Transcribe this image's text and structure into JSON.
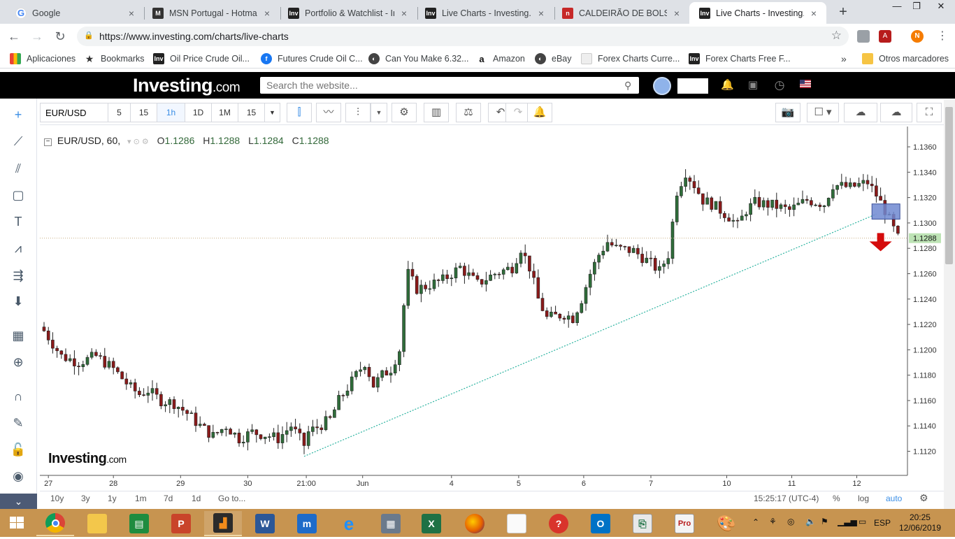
{
  "browser": {
    "tabs": [
      {
        "title": "Google",
        "favicon": "google-icon",
        "color": "#4285f4"
      },
      {
        "title": "MSN Portugal - Hotmail,",
        "favicon": "msn-icon",
        "color": "#333333"
      },
      {
        "title": "Portfolio & Watchlist - In",
        "favicon": "investing-icon",
        "color": "#222222"
      },
      {
        "title": "Live Charts - Investing.co",
        "favicon": "investing-icon",
        "color": "#222222"
      },
      {
        "title": "CALDEIRÃO DE BOLSA -",
        "favicon": "caldeirao-icon",
        "color": "#c62828"
      },
      {
        "title": "Live Charts - Investing.co",
        "favicon": "investing-icon",
        "color": "#222222",
        "active": true
      }
    ],
    "url": "https://www.investing.com/charts/live-charts",
    "profile_initial": "N",
    "bookmarks": [
      {
        "label": "Aplicaciones",
        "icon": "apps-grid-icon"
      },
      {
        "label": "Bookmarks",
        "icon": "star-icon"
      },
      {
        "label": "Oil Price  Crude Oil...",
        "icon": "investing-icon"
      },
      {
        "label": "Futures Crude Oil C...",
        "icon": "facebook-icon"
      },
      {
        "label": "Can You Make 6.32...",
        "icon": "globe-icon"
      },
      {
        "label": "Amazon",
        "icon": "amazon-icon"
      },
      {
        "label": "eBay",
        "icon": "globe-icon"
      },
      {
        "label": "Forex Charts  Curre...",
        "icon": "page-icon"
      },
      {
        "label": "Forex Charts  Free F...",
        "icon": "investing-icon"
      }
    ],
    "bookmarks_more": "»",
    "other_bookmarks": "Otros marcadores"
  },
  "investing": {
    "logo": "Investing",
    "logo_suffix": ".com",
    "search_placeholder": "Search the website..."
  },
  "chart_toolbar": {
    "symbol": "EUR/USD",
    "intervals": [
      "5",
      "15",
      "1h",
      "1D",
      "1M",
      "15"
    ],
    "selected_interval": "1h"
  },
  "legend": {
    "title": "EUR/USD, 60,",
    "o_label": "O",
    "o_value": "1.1286",
    "h_label": "H",
    "h_value": "1.1288",
    "l_label": "L",
    "l_value": "1.1284",
    "c_label": "C",
    "c_value": "1.1288"
  },
  "watermark": {
    "logo": "Investing",
    "suffix": ".com"
  },
  "range_bar": {
    "ranges": [
      "10y",
      "3y",
      "1y",
      "1m",
      "7d",
      "1d"
    ],
    "goto": "Go to...",
    "time": "15:25:17 (UTC-4)",
    "percent": "%",
    "log": "log",
    "auto": "auto"
  },
  "taskbar": {
    "language": "ESP",
    "time": "20:25",
    "date": "12/06/2019"
  },
  "colors": {
    "candle_up": "#2f6d3a",
    "candle_down": "#8b1a1a",
    "trendline": "#2bb3a0",
    "price_line": "#c9b084",
    "price_tag": "#bde3b5",
    "highlight_box": "#6f88d1",
    "arrow": "#d40c0c"
  },
  "chart_data": {
    "type": "candlestick",
    "symbol": "EUR/USD",
    "interval": "60",
    "y_ticks": [
      1.136,
      1.134,
      1.132,
      1.13,
      1.128,
      1.126,
      1.124,
      1.122,
      1.12,
      1.118,
      1.116,
      1.114,
      1.112
    ],
    "y_tick_labels": [
      "1.1360",
      "1.1340",
      "1.1320",
      "1.1300",
      "1.1280",
      "1.1260",
      "1.1240",
      "1.1220",
      "1.1200",
      "1.1180",
      "1.1160",
      "1.1140",
      "1.1120"
    ],
    "ylim": [
      1.1101,
      1.1376
    ],
    "x_ticks": [
      "27",
      "28",
      "29",
      "30",
      "21:00",
      "Jun",
      "4",
      "5",
      "6",
      "7",
      "10",
      "11",
      "12"
    ],
    "last_price": "1.1288",
    "last_price_value": 1.1288,
    "close_path": [
      [
        0,
        1.1215
      ],
      [
        4,
        1.1195
      ],
      [
        8,
        1.119
      ],
      [
        12,
        1.1195
      ],
      [
        16,
        1.1185
      ],
      [
        20,
        1.117
      ],
      [
        22,
        1.1165
      ],
      [
        24,
        1.1168
      ],
      [
        27,
        1.116
      ],
      [
        30,
        1.1158
      ],
      [
        33,
        1.115
      ],
      [
        36,
        1.114
      ],
      [
        39,
        1.1132
      ],
      [
        42,
        1.114
      ],
      [
        45,
        1.113
      ],
      [
        48,
        1.1135
      ],
      [
        51,
        1.1133
      ],
      [
        54,
        1.113
      ],
      [
        57,
        1.114
      ],
      [
        60,
        1.1125
      ],
      [
        61,
        1.1135
      ],
      [
        66,
        1.1145
      ],
      [
        68,
        1.116
      ],
      [
        70,
        1.117
      ],
      [
        72,
        1.118
      ],
      [
        74,
        1.119
      ],
      [
        76,
        1.1172
      ],
      [
        78,
        1.118
      ],
      [
        80,
        1.1185
      ],
      [
        82,
        1.12
      ],
      [
        83,
        1.1235
      ],
      [
        84,
        1.126
      ],
      [
        86,
        1.1248
      ],
      [
        88,
        1.125
      ],
      [
        92,
        1.1255
      ],
      [
        96,
        1.1265
      ],
      [
        100,
        1.1252
      ],
      [
        104,
        1.126
      ],
      [
        108,
        1.1265
      ],
      [
        110,
        1.128
      ],
      [
        112,
        1.1265
      ],
      [
        114,
        1.124
      ],
      [
        116,
        1.1225
      ],
      [
        120,
        1.1228
      ],
      [
        122,
        1.1225
      ],
      [
        124,
        1.124
      ],
      [
        126,
        1.126
      ],
      [
        128,
        1.1275
      ],
      [
        130,
        1.1285
      ],
      [
        132,
        1.128
      ],
      [
        136,
        1.1278
      ],
      [
        140,
        1.1268
      ],
      [
        142,
        1.1262
      ],
      [
        144,
        1.1275
      ],
      [
        146,
        1.1325
      ],
      [
        148,
        1.134
      ],
      [
        150,
        1.133
      ],
      [
        152,
        1.1318
      ],
      [
        154,
        1.1315
      ],
      [
        156,
        1.131
      ],
      [
        158,
        1.1305
      ],
      [
        160,
        1.1298
      ],
      [
        162,
        1.131
      ],
      [
        164,
        1.1316
      ],
      [
        168,
        1.1314
      ],
      [
        172,
        1.131
      ],
      [
        176,
        1.1318
      ],
      [
        180,
        1.1315
      ],
      [
        182,
        1.133
      ],
      [
        186,
        1.1328
      ],
      [
        190,
        1.1332
      ],
      [
        192,
        1.1322
      ],
      [
        194,
        1.131
      ],
      [
        196,
        1.1295
      ],
      [
        197,
        1.1288
      ]
    ],
    "trendline": [
      [
        60,
        1.1116
      ],
      [
        192,
        1.1307
      ]
    ],
    "annotations": [
      "highlight-box",
      "down-arrow"
    ]
  }
}
